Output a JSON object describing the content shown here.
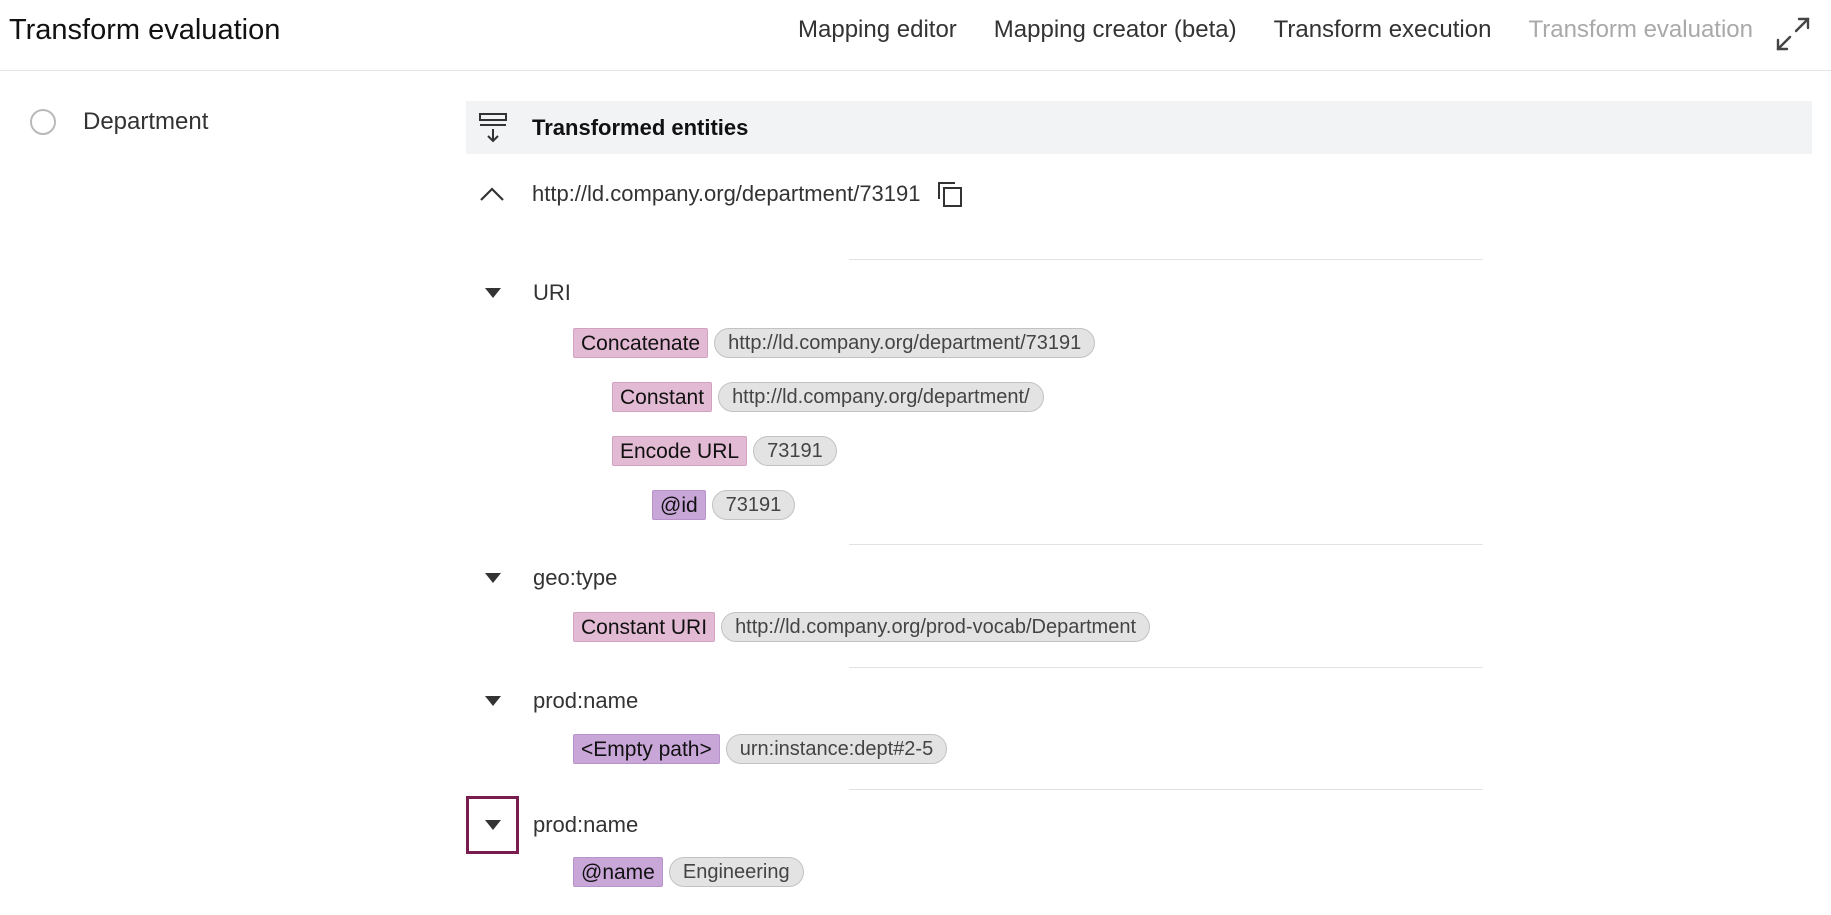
{
  "header": {
    "title": "Transform evaluation",
    "tabs": [
      {
        "label": "Mapping editor"
      },
      {
        "label": "Mapping creator (beta)"
      },
      {
        "label": "Transform execution"
      },
      {
        "label": "Transform evaluation"
      }
    ],
    "active_tab": "Transform evaluation",
    "expand_icon": "expand-icon"
  },
  "sidebar": {
    "items": [
      {
        "label": "Department",
        "selected": false
      }
    ]
  },
  "panel": {
    "title": "Transformed entities",
    "entity_uri": "http://ld.company.org/department/73191",
    "properties": [
      {
        "label": "URI",
        "operators": [
          {
            "label": "Concatenate",
            "kind": "function",
            "value": "http://ld.company.org/department/73191"
          },
          {
            "label": "Constant",
            "kind": "function",
            "value": "http://ld.company.org/department/"
          },
          {
            "label": "Encode URL",
            "kind": "function",
            "value": "73191"
          },
          {
            "label": "@id",
            "kind": "path",
            "value": "73191"
          }
        ]
      },
      {
        "label": "geo:type",
        "operators": [
          {
            "label": "Constant URI",
            "kind": "function",
            "value": "http://ld.company.org/prod-vocab/Department"
          }
        ]
      },
      {
        "label": "prod:name",
        "operators": [
          {
            "label": "<Empty path>",
            "kind": "path",
            "value": "urn:instance:dept#2-5"
          }
        ]
      },
      {
        "label": "prod:name",
        "operators": [
          {
            "label": "@name",
            "kind": "path",
            "value": "Engineering"
          }
        ]
      }
    ]
  },
  "colors": {
    "function_tag": "#e2bad3",
    "path_tag": "#c8a6d8",
    "value_pill": "#e3e3e3",
    "focus_outline": "#7a1c4e",
    "inactive_tab": "#a9a9a9"
  }
}
